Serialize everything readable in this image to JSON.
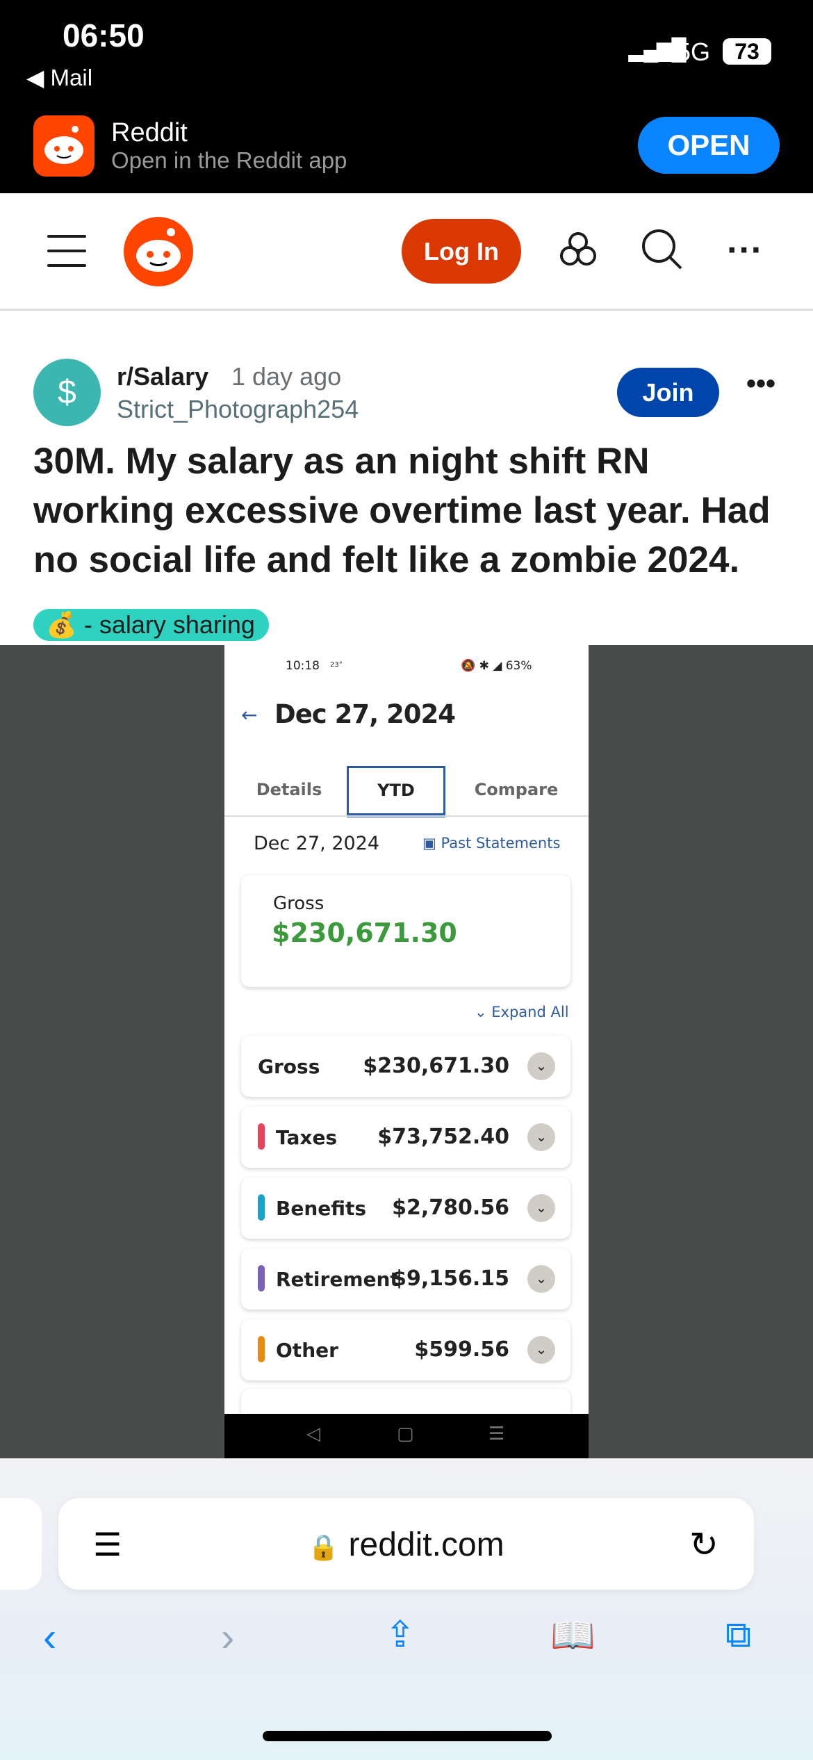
{
  "status_bar": {
    "time": "06:50",
    "back_app": "◀ Mail",
    "network": "5G",
    "battery": "73"
  },
  "app_banner": {
    "app_name": "Reddit",
    "subtitle": "Open in the Reddit app",
    "open_label": "OPEN"
  },
  "nav": {
    "login_label": "Log In"
  },
  "post": {
    "subreddit": "r/Salary",
    "time_ago": "1 day ago",
    "author": "Strict_Photograph254",
    "join_label": "Join",
    "title": "30M. My salary as an night shift RN working excessive overtime last year. Had no social life and felt like a zombie 2024.",
    "flair": "💰 - salary sharing"
  },
  "screenshot": {
    "status_time": "10:18",
    "status_temp": "23°",
    "status_icons": "🔕 ✱ ◢ 63%",
    "header": "Dec 27, 2024",
    "tabs": [
      "Details",
      "YTD",
      "Compare"
    ],
    "active_tab": "YTD",
    "date": "Dec 27, 2024",
    "past_statements": "Past Statements",
    "gross_label": "Gross",
    "gross_value": "$230,671.30",
    "expand_all": "Expand All",
    "rows": [
      {
        "label": "Gross",
        "value": "$230,671.30",
        "color": ""
      },
      {
        "label": "Taxes",
        "value": "$73,752.40",
        "color": "#e8435a"
      },
      {
        "label": "Benefits",
        "value": "$2,780.56",
        "color": "#1aa3c8"
      },
      {
        "label": "Retirement",
        "value": "$9,156.15",
        "color": "#7b62b8"
      },
      {
        "label": "Other",
        "value": "$599.56",
        "color": "#e88a12"
      }
    ]
  },
  "safari": {
    "url": "reddit.com"
  }
}
